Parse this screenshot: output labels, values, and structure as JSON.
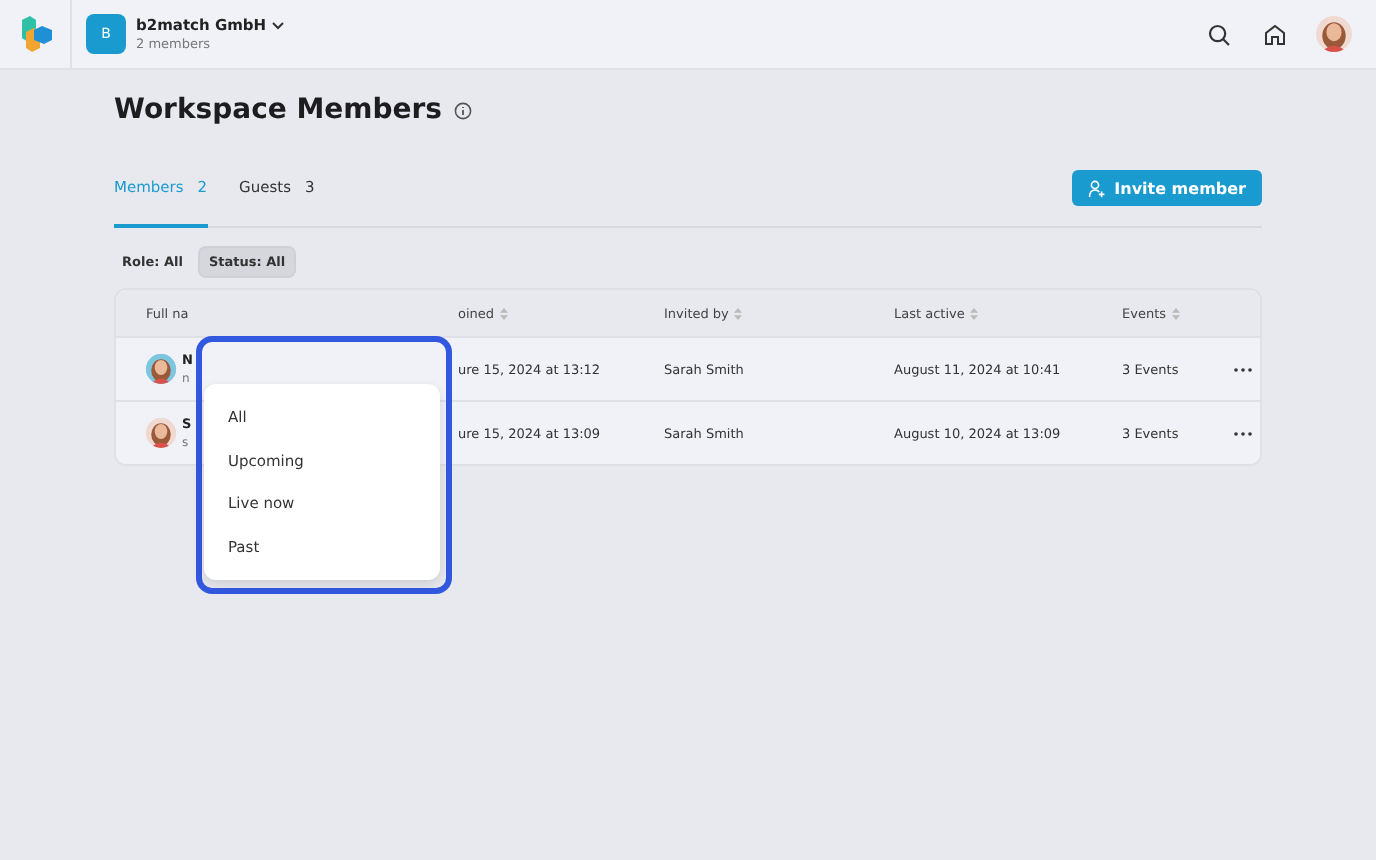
{
  "workspace": {
    "initial": "B",
    "name": "b2match GmbH",
    "subtitle": "2 members"
  },
  "page": {
    "title": "Workspace Members"
  },
  "tabs": [
    {
      "label": "Members",
      "count": "2",
      "selected": true
    },
    {
      "label": "Guests",
      "count": "3",
      "selected": false
    }
  ],
  "invite_button": "Invite member",
  "filters": [
    {
      "label": "Role: All",
      "open": false
    },
    {
      "label": "Status: All",
      "open": true
    }
  ],
  "table": {
    "columns": [
      "Full na",
      "oined",
      "Invited by",
      "Last active",
      "Events"
    ],
    "rows": [
      {
        "name": "N",
        "email": "n",
        "joined": "ure 15, 2024 at 13:12",
        "invited_by": "Sarah Smith",
        "last_active": "August 11, 2024 at 10:41",
        "events": "3 Events",
        "color": "#7ec6e0"
      },
      {
        "name": "S",
        "email": "s",
        "joined": "ure 15, 2024 at 13:09",
        "invited_by": "Sarah Smith",
        "last_active": "August 10, 2024 at 13:09",
        "events": "3 Events",
        "color": "#f0d9d0"
      }
    ]
  },
  "status_menu": {
    "options": [
      "All",
      "Upcoming",
      "Live now",
      "Past"
    ]
  }
}
